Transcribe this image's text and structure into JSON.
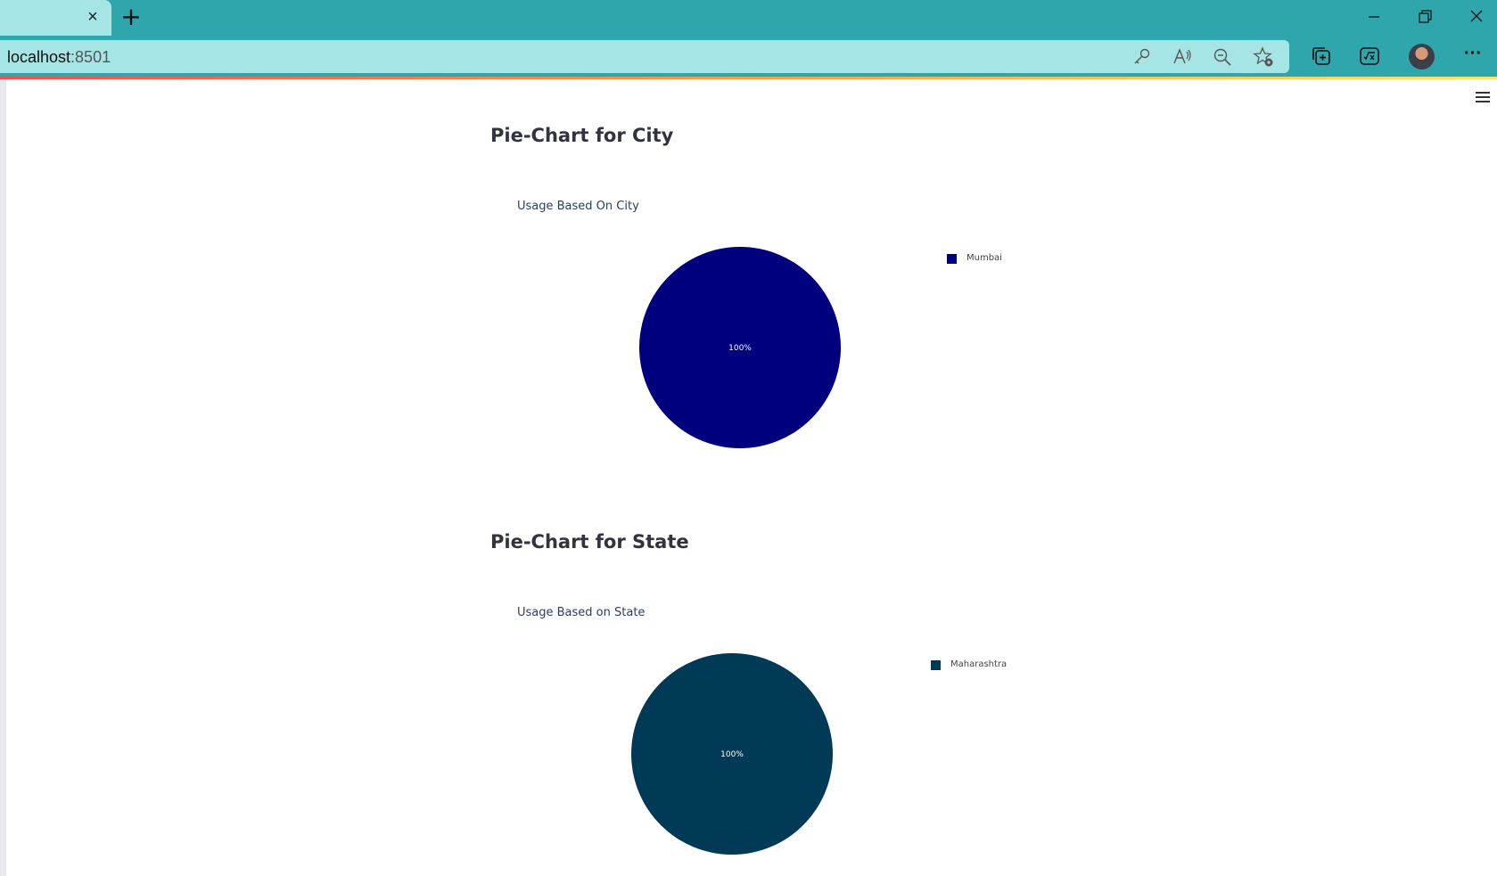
{
  "browser": {
    "url_host": "localhost",
    "url_port": ":8501",
    "new_tab_symbol": "+",
    "close_symbol": "×",
    "more_symbol": "···"
  },
  "page": {
    "city_section_heading": "Pie-Chart for City",
    "state_section_heading": "Pie-Chart for State"
  },
  "chart_data": [
    {
      "type": "pie",
      "title": "Usage Based On City",
      "categories": [
        "Mumbai"
      ],
      "values": [
        100
      ],
      "labels": [
        "100%"
      ],
      "colors": [
        "#00007f"
      ],
      "legend_position": "top-right"
    },
    {
      "type": "pie",
      "title": "Usage Based on State",
      "categories": [
        "Maharashtra"
      ],
      "values": [
        100
      ],
      "labels": [
        "100%"
      ],
      "colors": [
        "#003a57"
      ],
      "legend_position": "top-right"
    }
  ]
}
